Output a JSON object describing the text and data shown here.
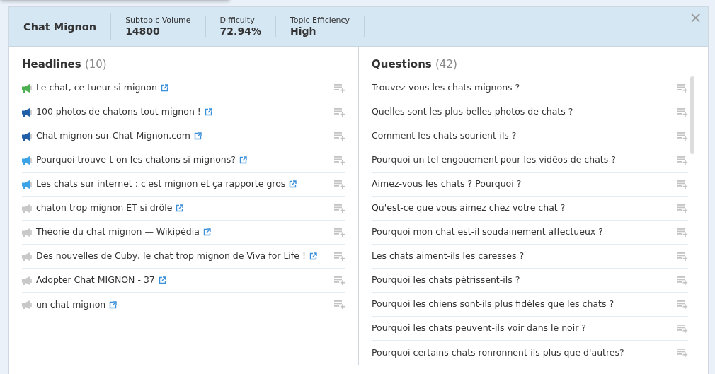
{
  "header": {
    "title": "Chat Mignon",
    "metrics": [
      {
        "label": "Subtopic Volume",
        "value": "14800"
      },
      {
        "label": "Difficulty",
        "value": "72.94%"
      },
      {
        "label": "Topic Efficiency",
        "value": "High"
      }
    ],
    "close": "×"
  },
  "headlines": {
    "title": "Headlines",
    "count": "(10)",
    "items": [
      {
        "text": "Le chat, ce tueur si mignon",
        "color": "#4caf50"
      },
      {
        "text": "100 photos de chatons tout mignon !",
        "color": "#1f5fa8"
      },
      {
        "text": "Chat mignon sur Chat-Mignon.com",
        "color": "#1f5fa8"
      },
      {
        "text": "Pourquoi trouve-t-on les chatons si mignons?",
        "color": "#3ba3e6"
      },
      {
        "text": "Les chats sur internet : c'est mignon et ça rapporte gros",
        "color": "#3ba3e6"
      },
      {
        "text": "chaton trop mignon ET si drôle",
        "color": "#c8c8c8"
      },
      {
        "text": "Théorie du chat mignon — Wikipédia",
        "color": "#c8c8c8"
      },
      {
        "text": "Des nouvelles de Cuby, le chat trop mignon de Viva for Life !",
        "color": "#c8c8c8"
      },
      {
        "text": "Adopter Chat MIGNON - 37",
        "color": "#c8c8c8"
      },
      {
        "text": "un chat mignon",
        "color": "#c8c8c8"
      }
    ]
  },
  "questions": {
    "title": "Questions",
    "count": "(42)",
    "items": [
      "Trouvez-vous les chats mignons ?",
      "Quelles sont les plus belles photos de chats ?",
      "Comment les chats sourient-ils ?",
      "Pourquoi un tel engouement pour les vidéos de chats ?",
      "Aimez-vous les chats ? Pourquoi ?",
      "Qu'est-ce que vous aimez chez votre chat ?",
      "Pourquoi mon chat est-il soudainement affectueux ?",
      "Les chats aiment-ils les caresses ?",
      "Pourquoi les chats pétrissent-ils ?",
      "Pourquoi les chiens sont-ils plus fidèles que les chats ?",
      "Pourquoi les chats peuvent-ils voir dans le noir ?",
      "Pourquoi certains chats ronronnent-ils plus que d'autres?"
    ]
  }
}
